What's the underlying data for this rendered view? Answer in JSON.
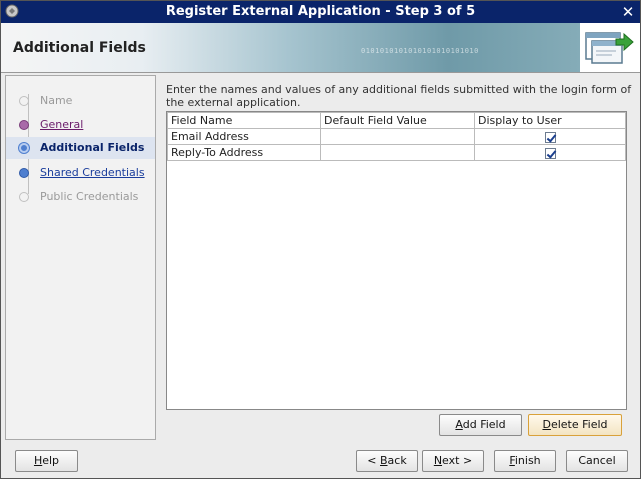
{
  "window": {
    "title": "Register External Application - Step 3 of 5",
    "close_label": "✕"
  },
  "banner": {
    "title": "Additional Fields",
    "binary_decor": "0101010101010101010101010"
  },
  "steps": [
    {
      "label": "Name",
      "state": "disabled"
    },
    {
      "label": "General",
      "state": "visited"
    },
    {
      "label": "Additional Fields",
      "state": "current"
    },
    {
      "label": "Shared Credentials",
      "state": "next"
    },
    {
      "label": "Public Credentials",
      "state": "disabled"
    }
  ],
  "instructions": "Enter the names and values of any additional fields submitted with the login form of the external application.",
  "table": {
    "columns": [
      "Field Name",
      "Default Field Value",
      "Display to User"
    ],
    "rows": [
      {
        "name": "Email Address",
        "default": "",
        "display": true
      },
      {
        "name": "Reply-To Address",
        "default": "",
        "display": true
      }
    ]
  },
  "buttons": {
    "add_field": {
      "mnemonic": "A",
      "rest": "dd Field"
    },
    "delete_field": {
      "mnemonic": "D",
      "rest": "elete Field"
    },
    "help": {
      "mnemonic": "H",
      "rest": "elp"
    },
    "back": {
      "pre": "< ",
      "mnemonic": "B",
      "rest": "ack"
    },
    "next": {
      "mnemonic": "N",
      "rest": "ext >"
    },
    "finish": {
      "mnemonic": "F",
      "rest": "inish"
    },
    "cancel": {
      "label": "Cancel"
    }
  }
}
